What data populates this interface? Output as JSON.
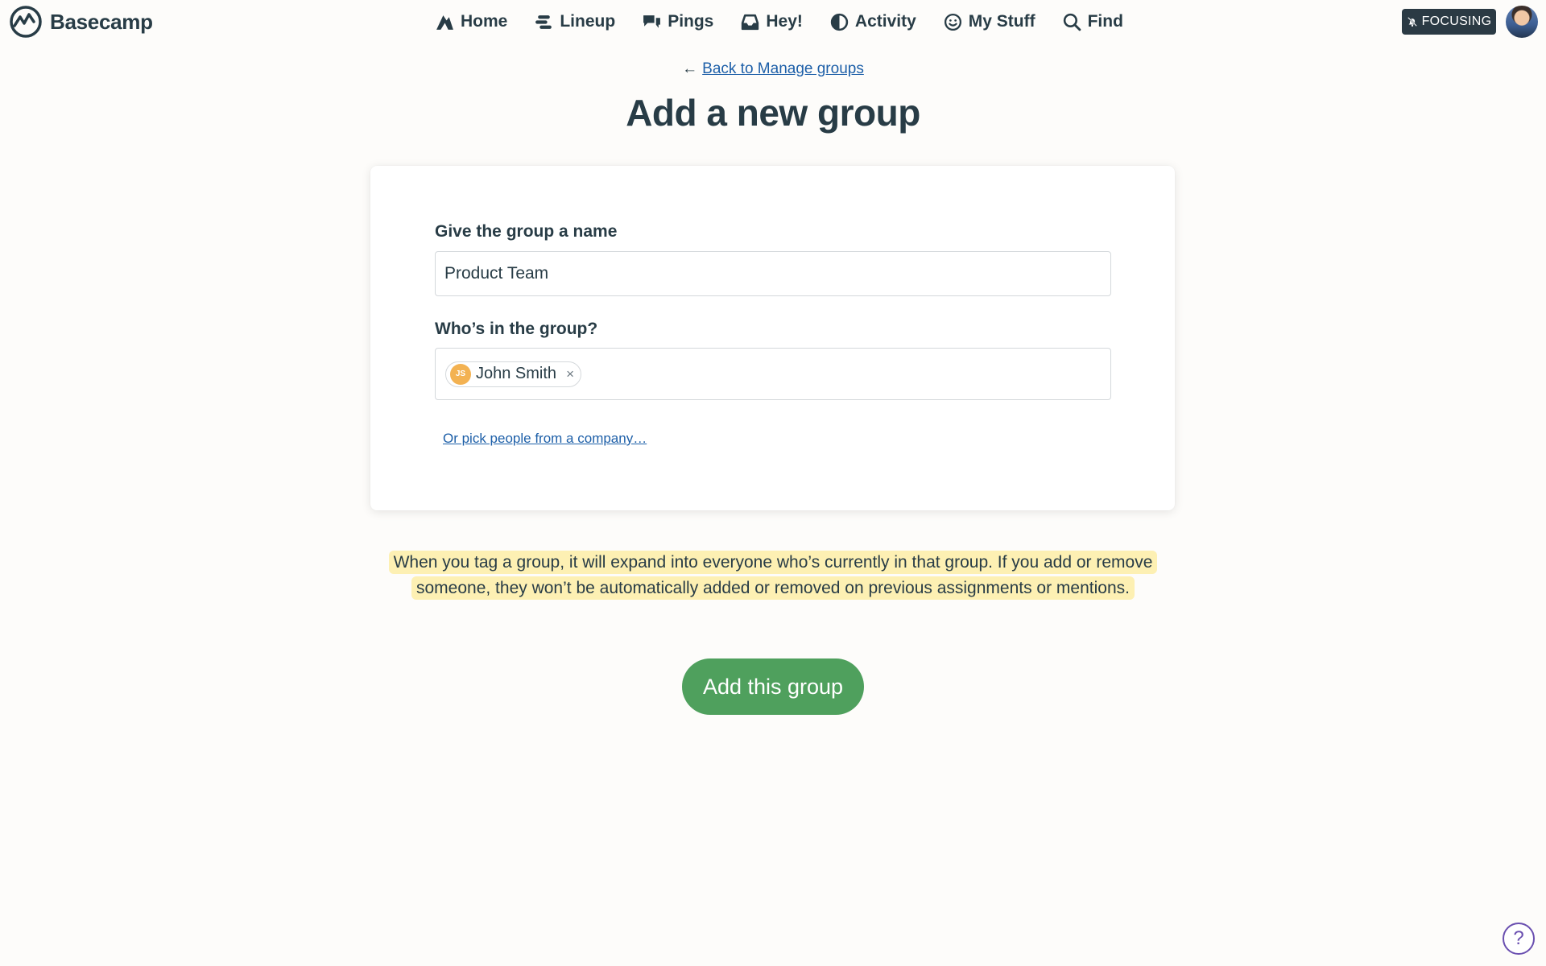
{
  "brand": {
    "name": "Basecamp",
    "logo_icon": "basecamp-logo-icon"
  },
  "nav": {
    "items": [
      {
        "label": "Home",
        "icon": "home-icon"
      },
      {
        "label": "Lineup",
        "icon": "lineup-icon"
      },
      {
        "label": "Pings",
        "icon": "pings-icon"
      },
      {
        "label": "Hey!",
        "icon": "inbox-icon"
      },
      {
        "label": "Activity",
        "icon": "activity-icon"
      },
      {
        "label": "My Stuff",
        "icon": "smiley-icon"
      },
      {
        "label": "Find",
        "icon": "search-icon"
      }
    ]
  },
  "focus": {
    "label": "FOCUSING",
    "icon": "bell-off-icon"
  },
  "header": {
    "back_arrow": "←",
    "back_link": "Back to Manage groups",
    "title": "Add a new group"
  },
  "form": {
    "name_label": "Give the group a name",
    "name_value": "Product Team",
    "members_label": "Who’s in the group?",
    "members": [
      {
        "initials": "JS",
        "name": "John Smith",
        "remove": "×"
      }
    ],
    "pick_link": "Or pick people from a company…"
  },
  "note": "When you tag a group, it will expand into everyone who’s currently in that group. If you add or remove someone, they won’t be automatically added or removed on previous assignments or mentions.",
  "submit": {
    "label": "Add this group"
  },
  "help": {
    "label": "?"
  },
  "colors": {
    "text": "#283c46",
    "link": "#1d5fa8",
    "primary_button": "#4fa05d",
    "note_highlight": "#fdf0b3",
    "chip_avatar": "#f3b252",
    "focus_badge": "#2b3a44",
    "help_accent": "#6a4fb0",
    "background": "#fdfcfa"
  }
}
